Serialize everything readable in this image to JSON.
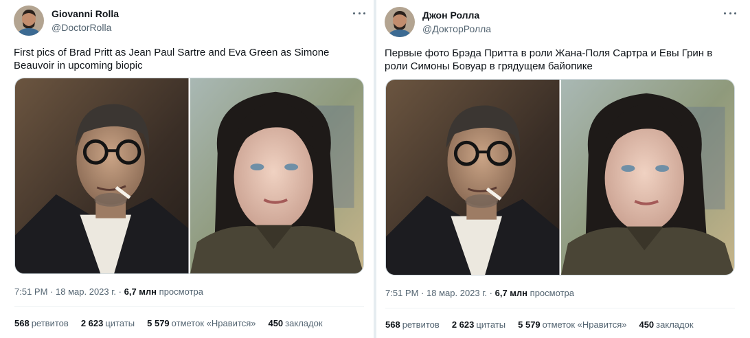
{
  "tweets": [
    {
      "author_name": "Giovanni Rolla",
      "author_handle": "@DoctorRolla",
      "text": "First pics of Brad Pritt as Jean Paul Sartre and Eva Green as Simone Beauvoir in upcoming biopic",
      "time": "7:51 PM",
      "date": "18 мар. 2023 г.",
      "views_count": "6,7 млн",
      "views_label": "просмотра",
      "stats": [
        {
          "num": "568",
          "label": "ретвитов"
        },
        {
          "num": "2 623",
          "label": "цитаты"
        },
        {
          "num": "5 579",
          "label": "отметок «Нравится»"
        },
        {
          "num": "450",
          "label": "закладок"
        }
      ]
    },
    {
      "author_name": "Джон Ролла",
      "author_handle": "@ДокторРолла",
      "text": "Первые фото Брэда Притта в роли Жана-Поля Сартра и Евы Грин в роли Симоны Бовуар в грядущем байопике",
      "time": "7:51 PM",
      "date": "18 мар. 2023 г.",
      "views_count": "6,7 млн",
      "views_label": "просмотра",
      "stats": [
        {
          "num": "568",
          "label": "ретвитов"
        },
        {
          "num": "2 623",
          "label": "цитаты"
        },
        {
          "num": "5 579",
          "label": "отметок «Нравится»"
        },
        {
          "num": "450",
          "label": "закладок"
        }
      ]
    }
  ],
  "separator": "·",
  "icons": {
    "more": "more-horizontal-icon"
  },
  "colors": {
    "text": "#0f1419",
    "secondary": "#536471",
    "border": "#cfd9de",
    "background": "#e6ecf0"
  }
}
